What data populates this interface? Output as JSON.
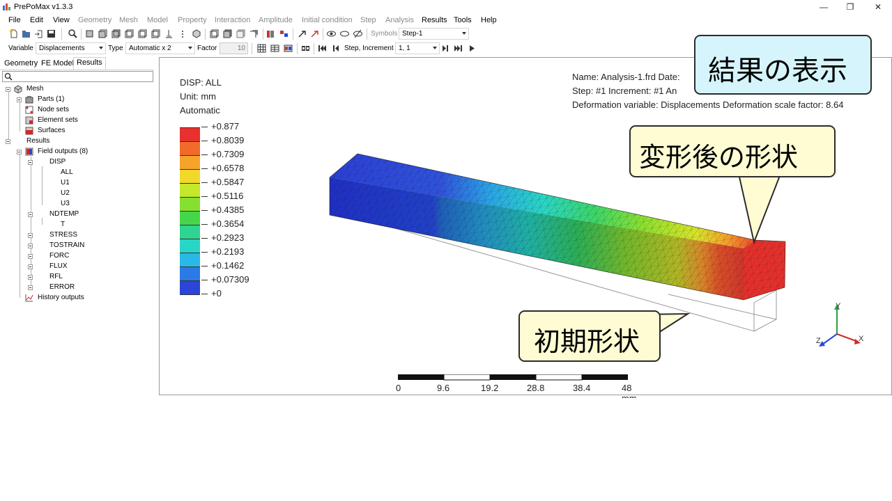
{
  "window": {
    "title": "PrePoMax v1.3.3",
    "minimize": "—",
    "maximize": "❐",
    "close": "✕"
  },
  "menu": [
    "File",
    "Edit",
    "View",
    "Geometry",
    "Mesh",
    "Model",
    "Property",
    "Interaction",
    "Amplitude",
    "Initial condition",
    "Step",
    "Analysis",
    "Results",
    "Tools",
    "Help"
  ],
  "menu_disabled": [
    "Geometry",
    "Mesh",
    "Model",
    "Property",
    "Interaction",
    "Amplitude",
    "Initial condition",
    "Step",
    "Analysis"
  ],
  "toolbar1": {
    "symbols_label": "Symbols",
    "symbols_value": "Step-1"
  },
  "toolbar2": {
    "variable_label": "Variable",
    "variable_value": "Displacements",
    "type_label": "Type",
    "type_value": "Automatic x 2",
    "factor_label": "Factor",
    "factor_value": "10",
    "step_label": "Step, Increment",
    "step_value": "1, 1"
  },
  "tabs": [
    "Geometry",
    "FE Model",
    "Results"
  ],
  "active_tab": "Results",
  "tree": {
    "mesh": "Mesh",
    "parts": "Parts (1)",
    "node_sets": "Node sets",
    "element_sets": "Element sets",
    "surfaces": "Surfaces",
    "results": "Results",
    "field_outputs": "Field outputs (8)",
    "disp": "DISP",
    "all": "ALL",
    "u1": "U1",
    "u2": "U2",
    "u3": "U3",
    "ndtemp": "NDTEMP",
    "t": "T",
    "stress": "STRESS",
    "tostrain": "TOSTRAIN",
    "forc": "FORC",
    "flux": "FLUX",
    "rfl": "RFL",
    "error": "ERROR",
    "history_outputs": "History outputs"
  },
  "legend": {
    "title": "DISP: ALL",
    "unit": "Unit: mm",
    "mode": "Automatic",
    "ticks": [
      "+0.877",
      "+0.8039",
      "+0.7309",
      "+0.6578",
      "+0.5847",
      "+0.5116",
      "+0.4385",
      "+0.3654",
      "+0.2923",
      "+0.2193",
      "+0.1462",
      "+0.07309",
      "+0"
    ],
    "colors": [
      "#e8312e",
      "#f06b2b",
      "#f5a42a",
      "#f1d92a",
      "#c4e82a",
      "#86e030",
      "#46d64a",
      "#2fd492",
      "#29d6c6",
      "#29b8e8",
      "#2a7be6",
      "#2b45d8"
    ]
  },
  "info": {
    "line1": "Name: Analysis-1.frd   Date:",
    "line2": "Step: #1   Increment: #1   An",
    "line3": "Deformation variable: Displacements   Deformation scale factor: 8.64"
  },
  "scale_bar": {
    "labels": [
      "0",
      "9.6",
      "19.2",
      "28.8",
      "38.4",
      "48 mm"
    ]
  },
  "axes": {
    "y": "Y",
    "z": "Z",
    "x": "X"
  },
  "callouts": {
    "results": "結果の表示",
    "deformed": "変形後の形状",
    "initial": "初期形状"
  }
}
